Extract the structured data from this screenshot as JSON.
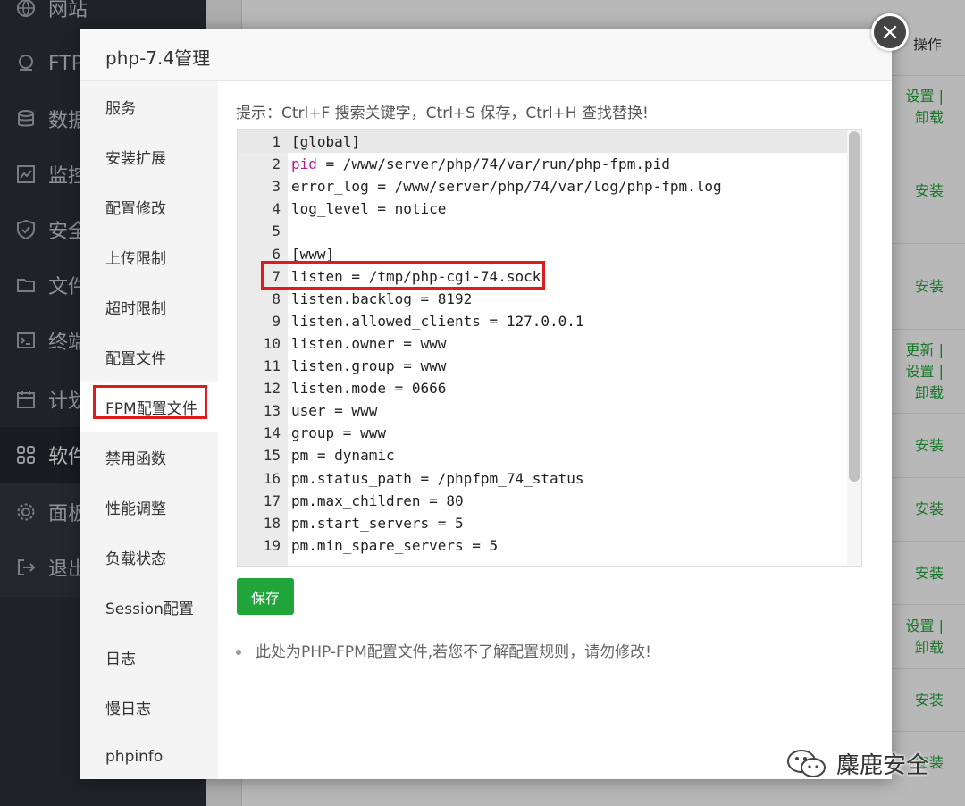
{
  "sidebar": {
    "items": [
      {
        "label": "网站",
        "icon": "globe-icon"
      },
      {
        "label": "FTP",
        "icon": "ftp-icon"
      },
      {
        "label": "数据",
        "icon": "database-icon"
      },
      {
        "label": "监控",
        "icon": "monitor-icon"
      },
      {
        "label": "安全",
        "icon": "shield-icon"
      },
      {
        "label": "文件",
        "icon": "folder-icon"
      },
      {
        "label": "终端",
        "icon": "terminal-icon"
      },
      {
        "label": "计划",
        "icon": "calendar-icon"
      },
      {
        "label": "软件",
        "icon": "apps-icon",
        "active": true
      },
      {
        "label": "面板",
        "icon": "gear-icon"
      },
      {
        "label": "退出",
        "icon": "logout-icon"
      }
    ]
  },
  "background": {
    "header_op": "操作",
    "actions": [
      "设置 |\n卸载",
      "安装",
      "安装",
      "更新 |\n设置 |\n卸载",
      "安装",
      "安装",
      "安装",
      "设置 |\n卸载",
      "安装",
      "安装"
    ]
  },
  "dialog": {
    "title": "php-7.4管理",
    "close_label": "×",
    "menu": [
      {
        "label": "服务"
      },
      {
        "label": "安装扩展"
      },
      {
        "label": "配置修改"
      },
      {
        "label": "上传限制"
      },
      {
        "label": "超时限制"
      },
      {
        "label": "配置文件"
      },
      {
        "label": "FPM配置文件",
        "active": true
      },
      {
        "label": "禁用函数"
      },
      {
        "label": "性能调整"
      },
      {
        "label": "负载状态"
      },
      {
        "label": "Session配置"
      },
      {
        "label": "日志"
      },
      {
        "label": "慢日志"
      },
      {
        "label": "phpinfo"
      }
    ],
    "hint": "提示：Ctrl+F 搜索关键字，Ctrl+S 保存，Ctrl+H 查找替换!",
    "code_lines": [
      "[global]",
      "pid = /www/server/php/74/var/run/php-fpm.pid",
      "error_log = /www/server/php/74/var/log/php-fpm.log",
      "log_level = notice",
      "",
      "[www]",
      "listen = /tmp/php-cgi-74.sock",
      "listen.backlog = 8192",
      "listen.allowed_clients = 127.0.0.1",
      "listen.owner = www",
      "listen.group = www",
      "listen.mode = 0666",
      "user = www",
      "group = www",
      "pm = dynamic",
      "pm.status_path = /phpfpm_74_status",
      "pm.max_children = 80",
      "pm.start_servers = 5",
      "pm.min_spare_servers = 5"
    ],
    "save_label": "保存",
    "note": "此处为PHP-FPM配置文件,若您不了解配置规则，请勿修改!"
  },
  "watermark": {
    "text": "麋鹿安全",
    "icon": "wechat-icon"
  },
  "colors": {
    "accent": "#20a53a",
    "highlight": "#e01b1b",
    "sidebar_bg": "#2c3138"
  }
}
